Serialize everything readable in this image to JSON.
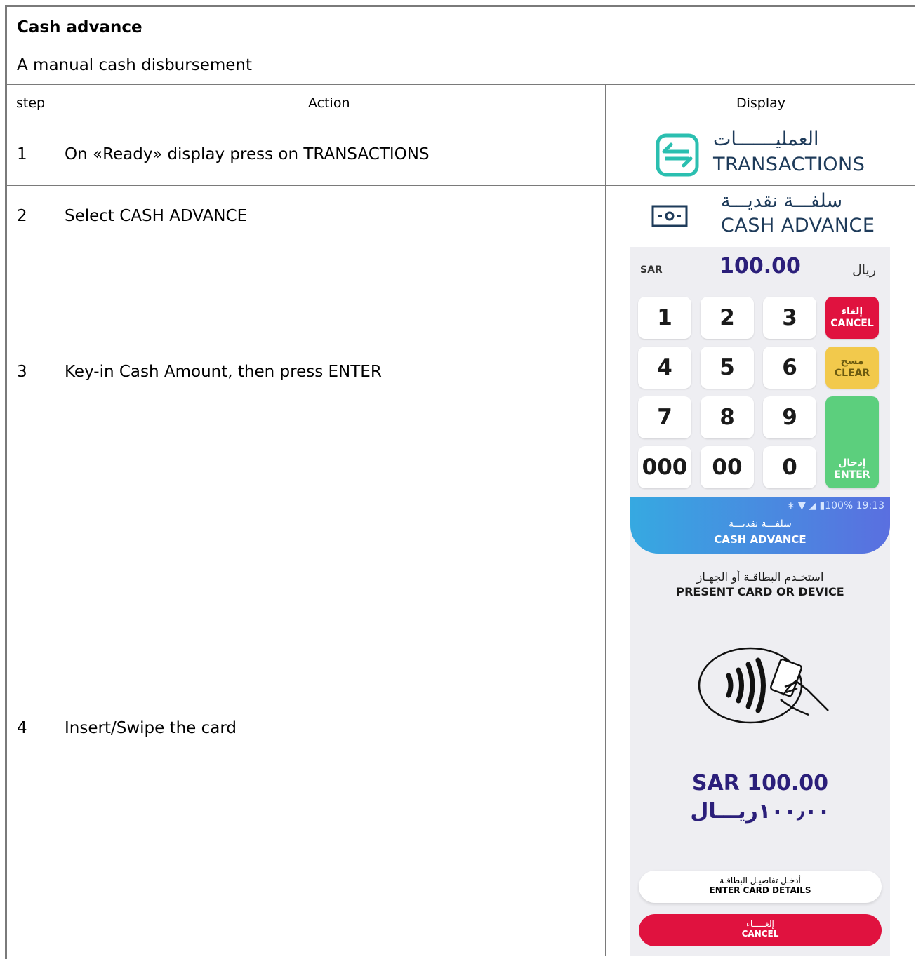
{
  "title": "Cash advance",
  "subtitle": "A manual cash disbursement",
  "headers": {
    "step": "step",
    "action": "Action",
    "display": "Display"
  },
  "rows": [
    {
      "step": "1",
      "action": "On «Ready» display press on TRANSACTIONS"
    },
    {
      "step": "2",
      "action": "Select CASH ADVANCE"
    },
    {
      "step": "3",
      "action": "Key-in Cash Amount, then press ENTER"
    },
    {
      "step": "4",
      "action": "Insert/Swipe the card"
    }
  ],
  "transactions_icon": {
    "label_ar": "العمليـــــــات",
    "label_en": "TRANSACTIONS",
    "icon": "transactions-icon",
    "color": "#2bbfb0"
  },
  "cash_advance_icon": {
    "label_ar": "سلفـــة نقديـــة",
    "label_en": "CASH ADVANCE",
    "icon": "cash-icon"
  },
  "keypad": {
    "currency_en": "SAR",
    "amount": "100.00",
    "currency_ar": "ريال",
    "keys": [
      "1",
      "2",
      "3",
      "4",
      "5",
      "6",
      "7",
      "8",
      "9",
      "000",
      "00",
      "0"
    ],
    "cancel_ar": "إلغاء",
    "cancel_en": "CANCEL",
    "clear_ar": "مسح",
    "clear_en": "CLEAR",
    "enter_ar": "إدخال",
    "enter_en": "ENTER"
  },
  "card_screen": {
    "status": "∗ ▼ ◢ ▮100% 19:13",
    "title_ar": "سلفـــة نقديـــة",
    "title_en": "CASH ADVANCE",
    "present_ar": "استخـدم البطاقـة أو الجهـاز",
    "present_en": "PRESENT CARD OR DEVICE",
    "amount_en": "SAR 100.00",
    "amount_ar": "١٠٠٫٠٠ريـــال",
    "details_ar": "أدخـل تفاصيـل البطاقـة",
    "details_en": "ENTER CARD DETAILS",
    "cancel_ar": "إلغـــــاء",
    "cancel_en": "CANCEL"
  }
}
